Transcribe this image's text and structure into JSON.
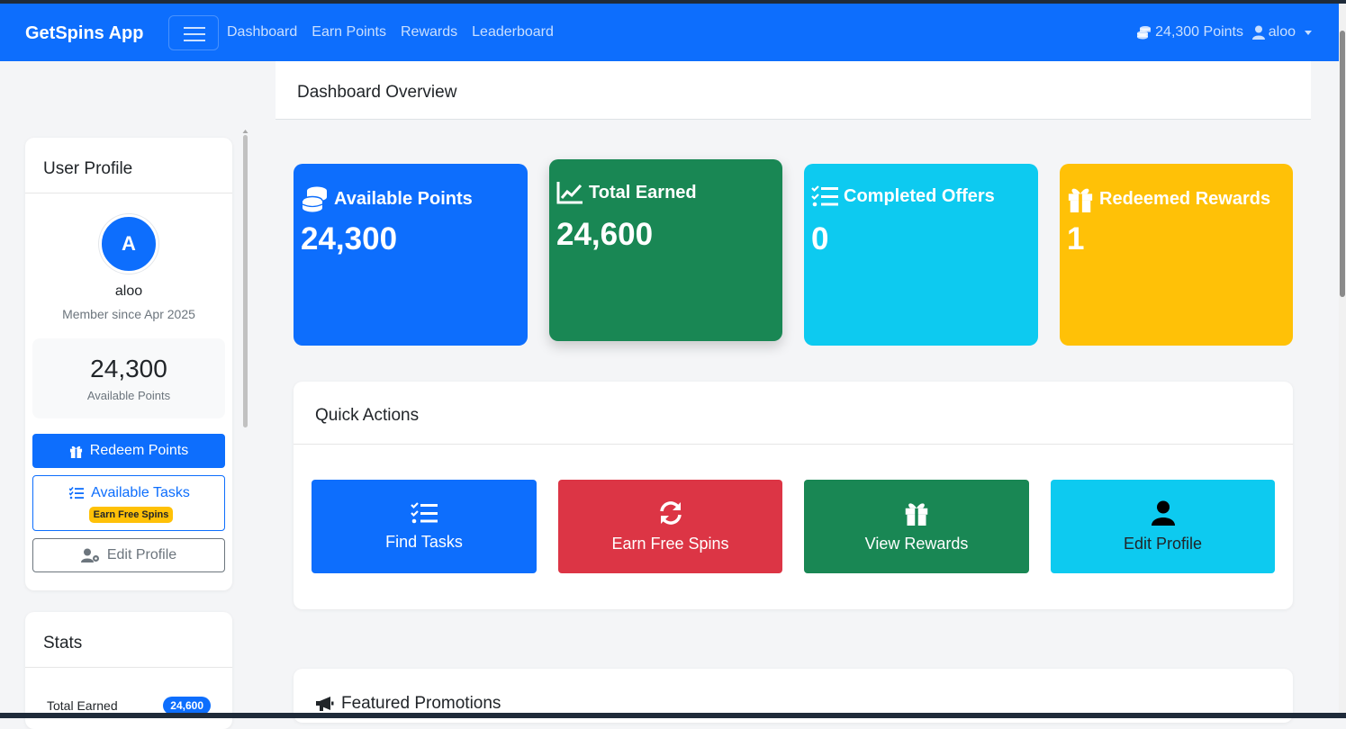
{
  "navbar": {
    "brand": "GetSpins App",
    "links": [
      "Dashboard",
      "Earn Points",
      "Rewards",
      "Leaderboard"
    ],
    "points": "24,300 Points",
    "user": "aloo"
  },
  "sidebar": {
    "profile": {
      "title": "User Profile",
      "avatar_letter": "A",
      "username": "aloo",
      "member_since": "Member since Apr 2025",
      "points": "24,300",
      "points_label": "Available Points",
      "redeem_label": "Redeem Points",
      "tasks_label": "Available Tasks",
      "tasks_badge": "Earn Free Spins",
      "edit_label": "Edit Profile"
    },
    "stats": {
      "title": "Stats",
      "total_earned_label": "Total Earned",
      "total_earned_value": "24,600"
    }
  },
  "main": {
    "title": "Dashboard Overview",
    "stat_cards": [
      {
        "label": "Available Points",
        "value": "24,300",
        "color": "#0d6efd",
        "icon": "coins-icon"
      },
      {
        "label": "Total Earned",
        "value": "24,600",
        "color": "#198754",
        "icon": "chart-line-icon"
      },
      {
        "label": "Completed Offers",
        "value": "0",
        "color": "#0dcaf0",
        "icon": "list-check-icon"
      },
      {
        "label": "Redeemed Rewards",
        "value": "1",
        "color": "#ffc107",
        "icon": "gift-icon"
      }
    ],
    "quick_actions": {
      "title": "Quick Actions",
      "buttons": [
        {
          "label": "Find Tasks",
          "color": "#0d6efd",
          "icon": "list-check-icon"
        },
        {
          "label": "Earn Free Spins",
          "color": "#dc3545",
          "icon": "sync-icon"
        },
        {
          "label": "View Rewards",
          "color": "#198754",
          "icon": "gift-icon"
        },
        {
          "label": "Edit Profile",
          "color": "#0dcaf0",
          "icon": "user-icon"
        }
      ]
    },
    "promotions": {
      "title": "Featured Promotions"
    }
  }
}
